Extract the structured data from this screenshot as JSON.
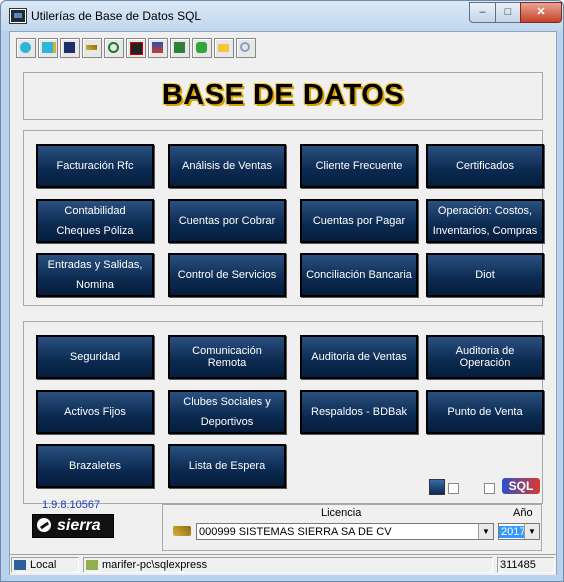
{
  "window": {
    "title": "Utilerías de Base de Datos SQL",
    "controls": {
      "minimize": "‒",
      "maximize": "□",
      "close": "✕"
    }
  },
  "toolbar": {
    "icons": [
      "new-icon",
      "edit-icon",
      "save-icon",
      "key-icon",
      "refresh-icon",
      "stop-icon",
      "users-icon",
      "print-icon",
      "recycle-icon",
      "folder-icon",
      "search-icon"
    ]
  },
  "banner": {
    "title": "BASE DE DATOS"
  },
  "modules_top": [
    "Facturación Rfc",
    "Análisis de Ventas",
    "Cliente Frecuente",
    "Certificados",
    "Contabilidad\nCheques Póliza",
    "Cuentas por Cobrar",
    "Cuentas por Pagar",
    "Operación:  Costos,\nInventarios,  Compras",
    "Entradas y Salidas,\nNomina",
    "Control de Servicios",
    "Conciliación Bancaria",
    "Diot"
  ],
  "modules_bottom": [
    "Seguridad",
    "Comunicación Remota",
    "Auditoria de Ventas",
    "Auditoria de Operación",
    "Activos Fijos",
    "Clubes Sociales y\nDeportivos",
    "Respaldos - BDBak",
    "Punto de Venta",
    "Brazaletes",
    "Lista de Espera"
  ],
  "footer": {
    "version": "1.9.8.10567",
    "logo_text": "sierra",
    "license_label": "Licencia",
    "license_value": "000999  SISTEMAS SIERRA SA DE CV",
    "year_label": "Año",
    "year_value": "2017",
    "sql_badge": "SQL"
  },
  "status": {
    "mode": "Local",
    "server": "marifer-pc\\sqlexpress",
    "code": "311485"
  },
  "colors": {
    "tile": "#0b2a50",
    "banner_shadow": "#d8a100",
    "window_frame": "#b9d1ea"
  }
}
